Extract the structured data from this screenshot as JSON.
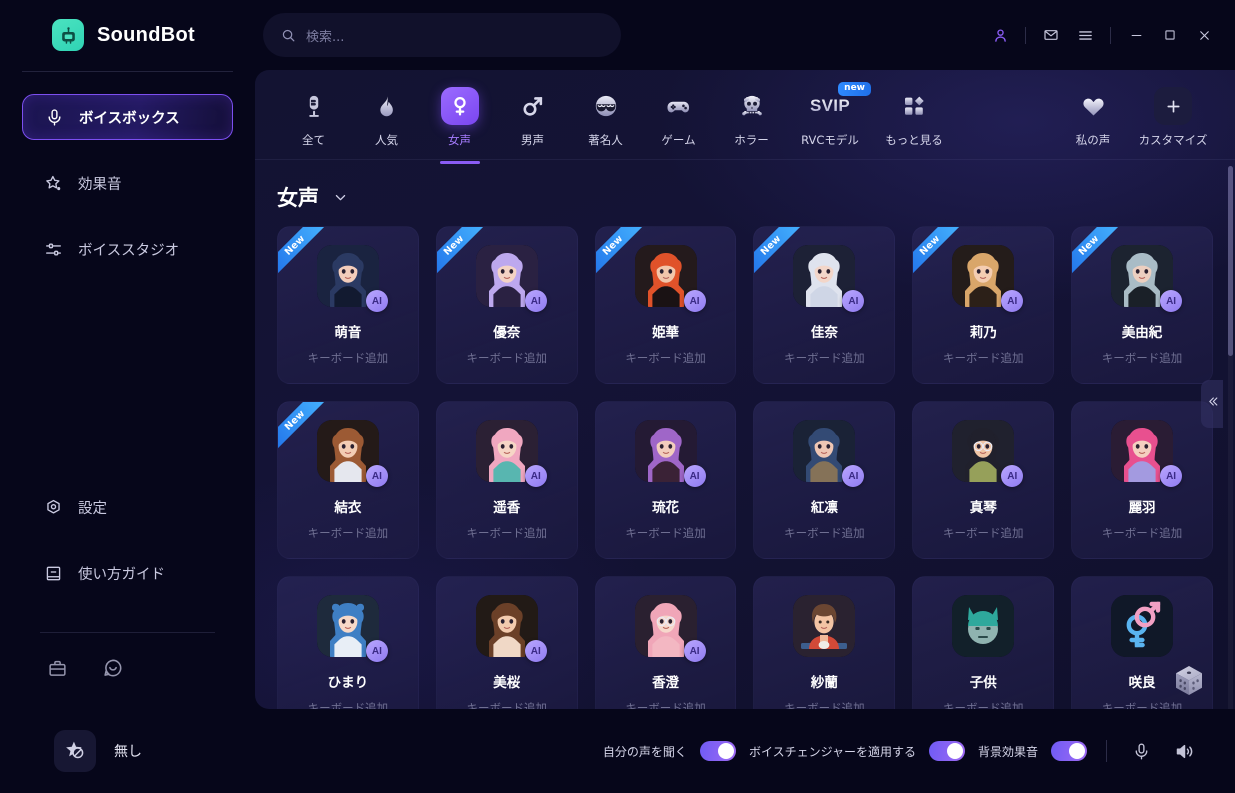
{
  "app": {
    "brand": "SoundBot",
    "logo_icon": "robot-icon"
  },
  "search": {
    "placeholder": "検索...",
    "value": "",
    "icon": "search-icon"
  },
  "window_controls": [
    {
      "name": "account-icon",
      "glyph": "account"
    },
    {
      "name": "mail-icon",
      "glyph": "mail"
    },
    {
      "name": "menu-icon",
      "glyph": "menu"
    },
    {
      "name": "minimize-button",
      "glyph": "minimize"
    },
    {
      "name": "maximize-button",
      "glyph": "maximize"
    },
    {
      "name": "close-button",
      "glyph": "close"
    }
  ],
  "sidebar": {
    "items": [
      {
        "label": "ボイスボックス",
        "icon": "microphone-icon",
        "active": true
      },
      {
        "label": "効果音",
        "icon": "sparkle-icon",
        "active": false
      },
      {
        "label": "ボイススタジオ",
        "icon": "sliders-icon",
        "active": false
      }
    ],
    "bottom_items": [
      {
        "label": "設定",
        "icon": "gear-icon"
      },
      {
        "label": "使い方ガイド",
        "icon": "book-icon"
      }
    ],
    "mini_items": [
      {
        "name": "briefcase-icon"
      },
      {
        "name": "chat-icon"
      }
    ]
  },
  "categories": [
    {
      "label": "全て",
      "icon": "microphone-all-icon",
      "active": false,
      "badge": ""
    },
    {
      "label": "人気",
      "icon": "flame-icon",
      "active": false,
      "badge": ""
    },
    {
      "label": "女声",
      "icon": "female-icon",
      "active": true,
      "badge": ""
    },
    {
      "label": "男声",
      "icon": "male-icon",
      "active": false,
      "badge": ""
    },
    {
      "label": "著名人",
      "icon": "sunglasses-icon",
      "active": false,
      "badge": ""
    },
    {
      "label": "ゲーム",
      "icon": "gamepad-icon",
      "active": false,
      "badge": ""
    },
    {
      "label": "ホラー",
      "icon": "skull-icon",
      "active": false,
      "badge": ""
    },
    {
      "label": "RVCモデル",
      "icon": "svip-icon",
      "active": false,
      "badge": "new"
    },
    {
      "label": "もっと見る",
      "icon": "grid-icon",
      "active": false,
      "badge": ""
    }
  ],
  "categories_right": [
    {
      "label": "私の声",
      "icon": "heart-icon"
    },
    {
      "label": "カスタマイズ",
      "icon": "plus-icon"
    }
  ],
  "section": {
    "title": "女声",
    "chevron_icon": "chevron-down-icon"
  },
  "card_sub_label": "キーボード追加",
  "cards": [
    {
      "name": "萌音",
      "new": true,
      "ai": true,
      "avatar": "dark-blue-hair-girl"
    },
    {
      "name": "優奈",
      "new": true,
      "ai": true,
      "avatar": "lavender-hair-girl"
    },
    {
      "name": "姫華",
      "new": true,
      "ai": true,
      "avatar": "red-hair-girl"
    },
    {
      "name": "佳奈",
      "new": true,
      "ai": true,
      "avatar": "white-hair-girl"
    },
    {
      "name": "莉乃",
      "new": true,
      "ai": true,
      "avatar": "blonde-hair-girl"
    },
    {
      "name": "美由紀",
      "new": true,
      "ai": true,
      "avatar": "silver-hair-girl"
    },
    {
      "name": "結衣",
      "new": true,
      "ai": true,
      "avatar": "brown-curly-girl"
    },
    {
      "name": "遥香",
      "new": false,
      "ai": true,
      "avatar": "pink-hair-girl"
    },
    {
      "name": "琉花",
      "new": false,
      "ai": true,
      "avatar": "violet-hair-girl"
    },
    {
      "name": "紅凛",
      "new": false,
      "ai": true,
      "avatar": "navy-hair-girl"
    },
    {
      "name": "真琴",
      "new": false,
      "ai": true,
      "avatar": "glasses-bob-girl"
    },
    {
      "name": "麗羽",
      "new": false,
      "ai": true,
      "avatar": "magenta-hair-girl"
    },
    {
      "name": "ひまり",
      "new": false,
      "ai": true,
      "avatar": "blue-bow-girl"
    },
    {
      "name": "美桜",
      "new": false,
      "ai": true,
      "avatar": "brown-wavy-girl"
    },
    {
      "name": "香澄",
      "new": false,
      "ai": true,
      "avatar": "pink-glasses-girl"
    },
    {
      "name": "紗蘭",
      "new": false,
      "ai": false,
      "avatar": "flat-woman-red"
    },
    {
      "name": "子供",
      "new": false,
      "ai": false,
      "avatar": "teal-robot-child"
    },
    {
      "name": "咲良",
      "new": false,
      "ai": false,
      "avatar": "gender-symbols"
    }
  ],
  "panel_controls": {
    "collapse_icon": "chevron-double-left-icon",
    "random_icon": "dice-icon"
  },
  "bottombar": {
    "current_voice": "無し",
    "current_voice_icon": "star-none-icon",
    "toggles": [
      {
        "label": "自分の声を聞く",
        "on": true
      },
      {
        "label": "ボイスチェンジャーを適用する",
        "on": true
      },
      {
        "label": "背景効果音",
        "on": true
      }
    ],
    "actions": [
      {
        "name": "microphone-icon"
      },
      {
        "name": "speaker-icon"
      }
    ]
  },
  "colors": {
    "accent": "#8a5cf5",
    "brand_logo": "#3fd9bb",
    "ribbon": "#2f8bff",
    "toggle_on": "#8a5cf5",
    "panel_bg": "#131332",
    "shell_bg": "#06061a"
  }
}
